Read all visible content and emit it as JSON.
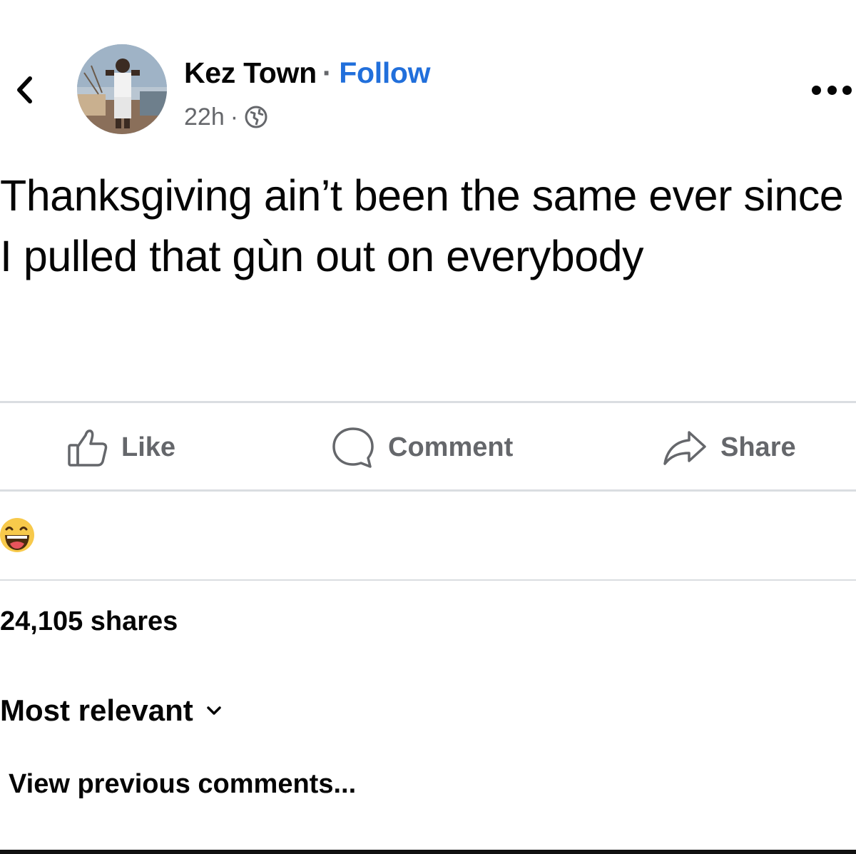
{
  "header": {
    "author_name": "Kez Town",
    "separator": "·",
    "follow_label": "Follow",
    "timestamp": "22h",
    "meta_separator": "·",
    "back_icon": "chevron-left-icon",
    "privacy_icon": "globe-icon",
    "more_icon": "more-horizontal-icon"
  },
  "post": {
    "text": "Thanksgiving ain’t been the same ever since I pulled that gùn out on everybody"
  },
  "actions": {
    "like_label": "Like",
    "comment_label": "Comment",
    "share_label": "Share"
  },
  "reactions": {
    "icon": "haha-reaction-icon"
  },
  "stats": {
    "shares": "24,105 shares"
  },
  "comments": {
    "sort_label": "Most relevant",
    "view_previous": "View previous comments..."
  },
  "colors": {
    "follow": "#216fdb",
    "secondary_text": "#65676b",
    "divider": "#dadde1",
    "reaction_yellow": "#f7c94b"
  }
}
